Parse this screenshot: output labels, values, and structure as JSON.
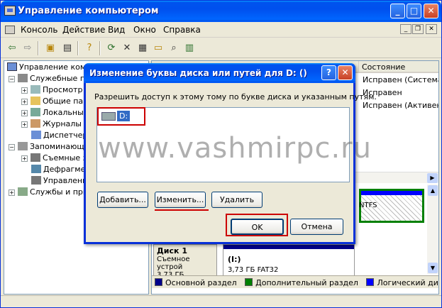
{
  "window": {
    "title": "Управление компьютером"
  },
  "menu": [
    "Консоль",
    "Действие",
    "Вид",
    "Окно",
    "Справка"
  ],
  "tree": {
    "items": [
      "Управление компь",
      "Служебные пр",
      "Просмотр с",
      "Общие папк",
      "Локальные",
      "Журналы и",
      "Диспетчер",
      "Запоминающ",
      "Съемные з",
      "Дефрагмен",
      "Управлени",
      "Службы и при"
    ]
  },
  "right_pane": {
    "header_status": "Состояние",
    "statuses": [
      "Исправен (Система)",
      "Исправен",
      "Исправен (Активен)"
    ],
    "ntfs_label": "NTFS",
    "disk1_name": "Диск 1",
    "disk1_type": "Съемное устрой",
    "disk1_size": "3,73 ГБ",
    "vol_label": "(I:)",
    "vol_info": "3,73 ГБ FAT32"
  },
  "legend": [
    {
      "label": "Основной раздел",
      "color": "#00008b"
    },
    {
      "label": "Дополнительный раздел",
      "color": "#008000"
    },
    {
      "label": "Логический диск",
      "color": "#0000ff"
    }
  ],
  "dialog": {
    "title": "Изменение буквы диска или путей для D: ()",
    "description": "Разрешить доступ к этому тому по букве диска и указанным путям.",
    "list_item": "D:",
    "add_button": "Добавить...",
    "change_button": "Изменить...",
    "delete_button": "Удалить",
    "ok_button": "OK",
    "cancel_button": "Отмена"
  },
  "watermark": "www.vashmirpc.ru",
  "colors": {
    "xp_blue": "#0054e3",
    "highlight": "#316ac5",
    "red_marker": "#cc0000"
  }
}
